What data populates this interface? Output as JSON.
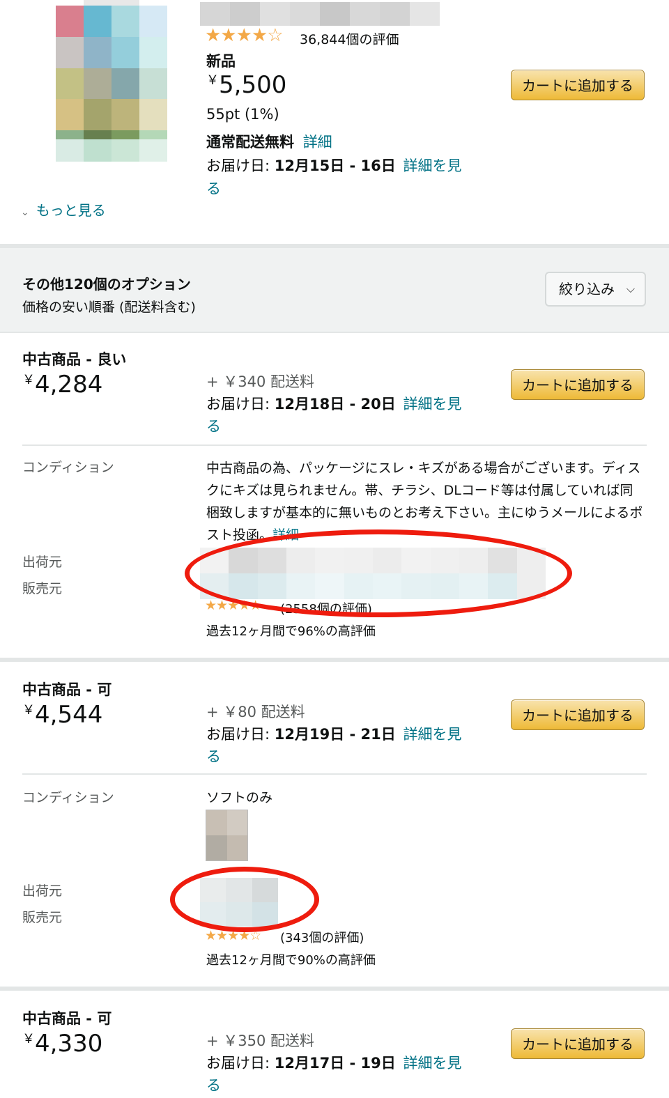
{
  "top": {
    "rating_count": "36,844個の評価",
    "condition": "新品",
    "price_symbol": "￥",
    "price": "5,500",
    "points": "55pt (1%)",
    "shipping_free": "通常配送無料",
    "shipping_detail_link": "詳細",
    "delivery_label": "お届け日: ",
    "delivery_dates": "12月15日 - 16日",
    "delivery_link_1": "詳細を見",
    "delivery_link_2": "る",
    "cart_label": "カートに追加する",
    "more_label": "もっと見る"
  },
  "options_header": {
    "title": "その他120個のオプション",
    "subtitle": "価格の安い順番 (配送料含む)",
    "filter_label": "絞り込み"
  },
  "offers": [
    {
      "condition": "中古商品 - 良い",
      "price_symbol": "￥",
      "price": "4,284",
      "shipping": "+ ￥340 配送料",
      "delivery_label": "お届け日: ",
      "delivery_dates": "12月18日 - 20日",
      "delivery_link_1": "詳細を見",
      "delivery_link_2": "る",
      "cart_label": "カートに追加する",
      "condition_label": "コンディション",
      "condition_text_1": "中古商品の為、パッケージにスレ・キズがある場合がございます。ディス",
      "condition_text_2": "クにキズは見られません。帯、チラシ、DLコード等は付属していれば同",
      "condition_text_3": "梱致しますが基本的に無いものとお考え下さい。主にゆうメールによるポ",
      "condition_text_4": "スト投函。",
      "condition_more_link": "詳細",
      "ships_from_label": "出荷元",
      "sold_by_label": "販売元",
      "seller_rating_count": "(2558個の評価)",
      "seller_positive": "過去12ヶ月間で96%の高評価"
    },
    {
      "condition": "中古商品 - 可",
      "price_symbol": "￥",
      "price": "4,544",
      "shipping": "+ ￥80 配送料",
      "delivery_label": "お届け日: ",
      "delivery_dates": "12月19日 - 21日",
      "delivery_link_1": "詳細を見",
      "delivery_link_2": "る",
      "cart_label": "カートに追加する",
      "condition_label": "コンディション",
      "condition_text_1": "ソフトのみ",
      "ships_from_label": "出荷元",
      "sold_by_label": "販売元",
      "seller_rating_count": "(343個の評価)",
      "seller_positive": "過去12ヶ月間で90%の高評価"
    },
    {
      "condition": "中古商品 - 可",
      "price_symbol": "￥",
      "price": "4,330",
      "shipping": "+ ￥350 配送料",
      "delivery_label": "お届け日: ",
      "delivery_dates": "12月17日 - 19日",
      "delivery_link_1": "詳細を見",
      "delivery_link_2": "る",
      "cart_label": "カートに追加する"
    }
  ],
  "colors": {
    "link": "#007185",
    "button": "#f0c14b",
    "star": "#f3a847",
    "annotation_ring": "#ee1c0e"
  }
}
